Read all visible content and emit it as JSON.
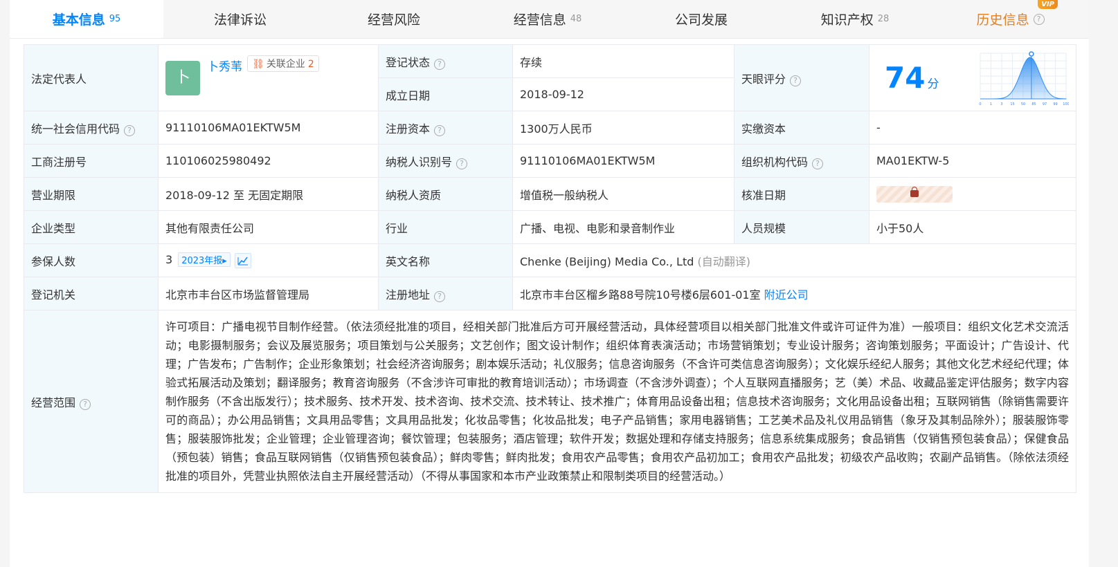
{
  "tabs": [
    {
      "label": "基本信息",
      "count": "95"
    },
    {
      "label": "法律诉讼"
    },
    {
      "label": "经营风险"
    },
    {
      "label": "经营信息",
      "count": "48"
    },
    {
      "label": "公司发展"
    },
    {
      "label": "知识产权",
      "count": "28"
    },
    {
      "label": "历史信息",
      "badge": "VIP"
    }
  ],
  "help_glyph": "?",
  "legal_rep": {
    "label": "法定代表人",
    "avatar_char": "卜",
    "name": "卜秀苇",
    "related_label": "关联企业",
    "related_count": "2"
  },
  "reg_status": {
    "label": "登记状态",
    "value": "存续"
  },
  "found_date": {
    "label": "成立日期",
    "value": "2018-09-12"
  },
  "tianyan_score": {
    "label": "天眼评分",
    "value": "74",
    "unit": "分",
    "chart_ticks": [
      "0",
      "1",
      "3",
      "15",
      "50",
      "85",
      "97",
      "99",
      "100"
    ],
    "chart_color": "#2e8df0"
  },
  "credit_code": {
    "label": "统一社会信用代码",
    "value": "91110106MA01EKTW5M"
  },
  "reg_capital": {
    "label": "注册资本",
    "value": "1300万人民币"
  },
  "paid_capital": {
    "label": "实缴资本",
    "value": "-"
  },
  "biz_reg_no": {
    "label": "工商注册号",
    "value": "110106025980492"
  },
  "taxpayer_id": {
    "label": "纳税人识别号",
    "value": "91110106MA01EKTW5M"
  },
  "org_code": {
    "label": "组织机构代码",
    "value": "MA01EKTW-5"
  },
  "biz_term": {
    "label": "营业期限",
    "value": "2018-09-12 至 无固定期限"
  },
  "taxpayer_qual": {
    "label": "纳税人资质",
    "value": "增值税一般纳税人"
  },
  "approve_date": {
    "label": "核准日期"
  },
  "company_type": {
    "label": "企业类型",
    "value": "其他有限责任公司"
  },
  "industry": {
    "label": "行业",
    "value": "广播、电视、电影和录音制作业"
  },
  "staff_size": {
    "label": "人员规模",
    "value": "小于50人"
  },
  "insured": {
    "label": "参保人数",
    "value": "3",
    "report": "2023年报"
  },
  "english_name": {
    "label": "英文名称",
    "value": "Chenke (Beijing) Media Co., Ltd",
    "note": "(自动翻译)"
  },
  "reg_authority": {
    "label": "登记机关",
    "value": "北京市丰台区市场监督管理局"
  },
  "reg_address": {
    "label": "注册地址",
    "value": "北京市丰台区榴乡路88号院10号楼6层601-01室",
    "nearby": "附近公司"
  },
  "biz_scope": {
    "label": "经营范围",
    "value": "许可项目：广播电视节目制作经营。（依法须经批准的项目，经相关部门批准后方可开展经营活动，具体经营项目以相关部门批准文件或许可证件为准）一般项目：组织文化艺术交流活动；电影摄制服务；会议及展览服务；项目策划与公关服务；文艺创作；图文设计制作；组织体育表演活动；市场营销策划；专业设计服务；咨询策划服务；平面设计；广告设计、代理；广告发布；广告制作；企业形象策划；社会经济咨询服务；剧本娱乐活动；礼仪服务；信息咨询服务（不含许可类信息咨询服务）；文化娱乐经纪人服务；其他文化艺术经纪代理；体验式拓展活动及策划；翻译服务；教育咨询服务（不含涉许可审批的教育培训活动）；市场调查（不含涉外调查）；个人互联网直播服务；艺（美）术品、收藏品鉴定评估服务；数字内容制作服务（不含出版发行）；技术服务、技术开发、技术咨询、技术交流、技术转让、技术推广；体育用品设备出租；信息技术咨询服务；文化用品设备出租；互联网销售（除销售需要许可的商品）；办公用品销售；文具用品零售；文具用品批发；化妆品零售；化妆品批发；电子产品销售；家用电器销售；工艺美术品及礼仪用品销售（象牙及其制品除外）；服装服饰零售；服装服饰批发；企业管理；企业管理咨询；餐饮管理；包装服务；酒店管理；软件开发；数据处理和存储支持服务；信息系统集成服务；食品销售（仅销售预包装食品）；保健食品（预包装）销售；食品互联网销售（仅销售预包装食品）；鲜肉零售；鲜肉批发；食用农产品零售；食用农产品初加工；食用农产品批发；初级农产品收购；农副产品销售。（除依法须经批准的项目外，凭营业执照依法自主开展经营活动）（不得从事国家和本市产业政策禁止和限制类项目的经营活动。）"
  }
}
